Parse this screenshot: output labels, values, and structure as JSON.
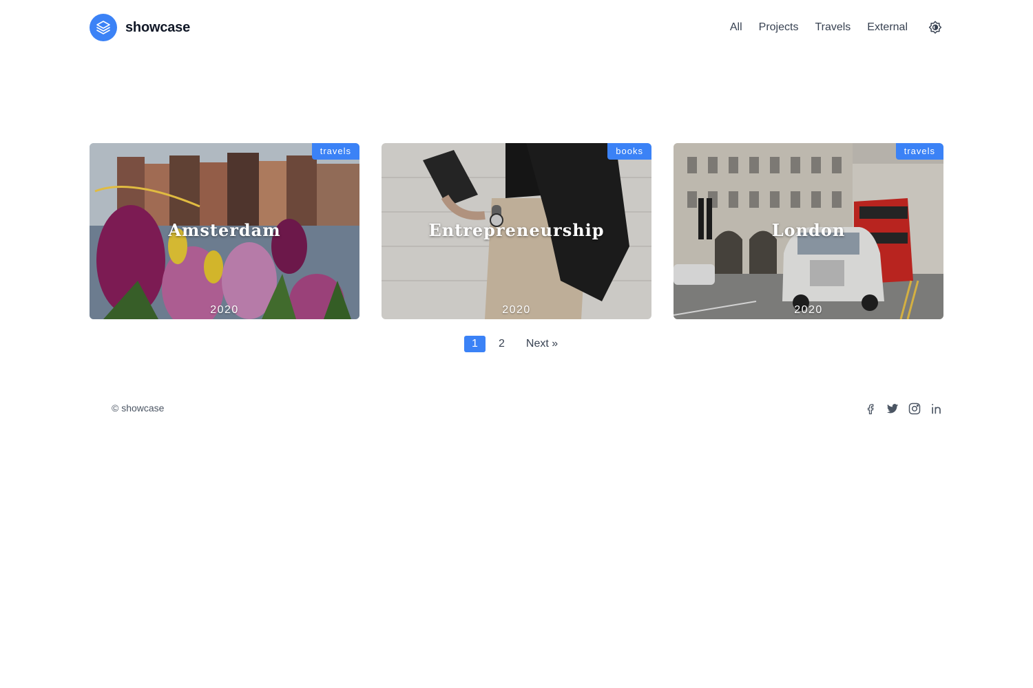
{
  "brand": {
    "name": "showcase",
    "icon": "layers-icon",
    "accent": "#3b82f6"
  },
  "nav": {
    "items": [
      {
        "label": "All"
      },
      {
        "label": "Projects"
      },
      {
        "label": "Travels"
      },
      {
        "label": "External"
      }
    ],
    "theme_icon": "sun-icon"
  },
  "cards": [
    {
      "title": "Amsterdam",
      "tag": "travels",
      "year": "2020"
    },
    {
      "title": "Entrepreneurship",
      "tag": "books",
      "year": "2020"
    },
    {
      "title": "London",
      "tag": "travels",
      "year": "2020"
    }
  ],
  "pagination": {
    "current": "1",
    "page2": "2",
    "next": "Next »"
  },
  "footer": {
    "copyright": "© showcase",
    "socials": [
      "facebook-icon",
      "twitter-icon",
      "instagram-icon",
      "linkedin-icon"
    ]
  }
}
